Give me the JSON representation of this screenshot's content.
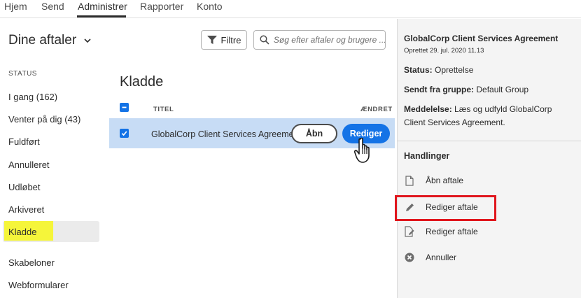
{
  "topnav": {
    "tabs": [
      {
        "label": "Hjem"
      },
      {
        "label": "Send"
      },
      {
        "label": "Administrer"
      },
      {
        "label": "Rapporter"
      },
      {
        "label": "Konto"
      }
    ],
    "active_tab": "Administrer"
  },
  "sidebar": {
    "title": "Dine aftaler",
    "status_heading": "STATUS",
    "items": [
      {
        "label": "I gang (162)"
      },
      {
        "label": "Venter på dig (43)"
      },
      {
        "label": "Fuldført"
      },
      {
        "label": "Annulleret"
      },
      {
        "label": "Udløbet"
      },
      {
        "label": "Arkiveret"
      },
      {
        "label": "Kladde"
      },
      {
        "label": "Skabeloner"
      },
      {
        "label": "Webformularer"
      }
    ],
    "selected": "Kladde"
  },
  "toolbar": {
    "filter_label": "Filtre",
    "search_placeholder": "Søg efter aftaler og brugere ..."
  },
  "main": {
    "section_title": "Kladde",
    "columns": {
      "title": "TITEL",
      "changed": "ÆNDRET"
    },
    "rows": [
      {
        "title": "GlobalCorp Client Services Agreement",
        "open_label": "Åbn",
        "edit_label": "Rediger",
        "checked": true
      }
    ]
  },
  "detail": {
    "title": "GlobalCorp Client Services Agreement",
    "created": "Oprettet 29. jul. 2020 11.13",
    "status_label": "Status:",
    "status_value": "Oprettelse",
    "group_label": "Sendt fra gruppe:",
    "group_value": "Default Group",
    "message_label": "Meddelelse:",
    "message_value": "Læs og udfyld GlobalCorp Client Services Agreement.",
    "actions_heading": "Handlinger",
    "actions": [
      {
        "label": "Åbn aftale",
        "icon": "document-icon"
      },
      {
        "label": "Rediger aftale",
        "icon": "pencil-icon"
      },
      {
        "label": "Rediger aftale",
        "icon": "document-edit-icon"
      },
      {
        "label": "Annuller",
        "icon": "cancel-icon"
      }
    ]
  },
  "colors": {
    "accent": "#1473e6",
    "selected_row": "#c7dcf5",
    "highlight": "#f5f53a",
    "callout": "#e0161d"
  }
}
